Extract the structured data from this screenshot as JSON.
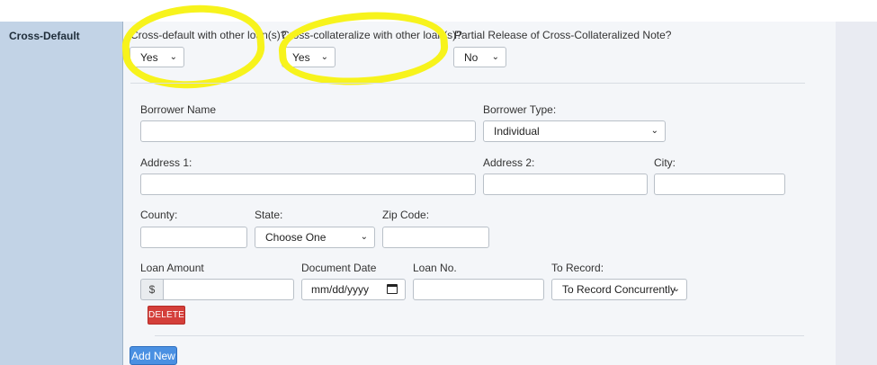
{
  "section": {
    "label": "Cross-Default"
  },
  "questions": [
    {
      "label": "Cross-default with other loan(s)?",
      "value": "Yes"
    },
    {
      "label": "Cross-collateralize with other loan(s)?",
      "value": "Yes"
    },
    {
      "label": "Partial Release of Cross-Collateralized Note?",
      "value": "No"
    }
  ],
  "form": {
    "borrower_name_label": "Borrower Name",
    "borrower_name_value": "",
    "borrower_type_label": "Borrower Type:",
    "borrower_type_value": "Individual",
    "address1_label": "Address 1:",
    "address2_label": "Address 2:",
    "city_label": "City:",
    "county_label": "County:",
    "state_label": "State:",
    "state_value": "Choose One",
    "zip_label": "Zip Code:",
    "loan_amount_label": "Loan Amount",
    "currency_symbol": "$",
    "document_date_label": "Document Date",
    "document_date_placeholder": "mm/dd/yyyy",
    "loan_no_label": "Loan No.",
    "to_record_label": "To Record:",
    "to_record_value": "To Record Concurrently"
  },
  "buttons": {
    "delete": "DELETE",
    "add_new": "Add New"
  },
  "icons": {
    "dropdown": "chevron-down-icon",
    "calendar": "calendar-icon"
  },
  "colors": {
    "sidebar": "#c2d3e6",
    "delete": "#d43f3a",
    "add": "#4a90e2",
    "highlight": "#f7f31c"
  }
}
